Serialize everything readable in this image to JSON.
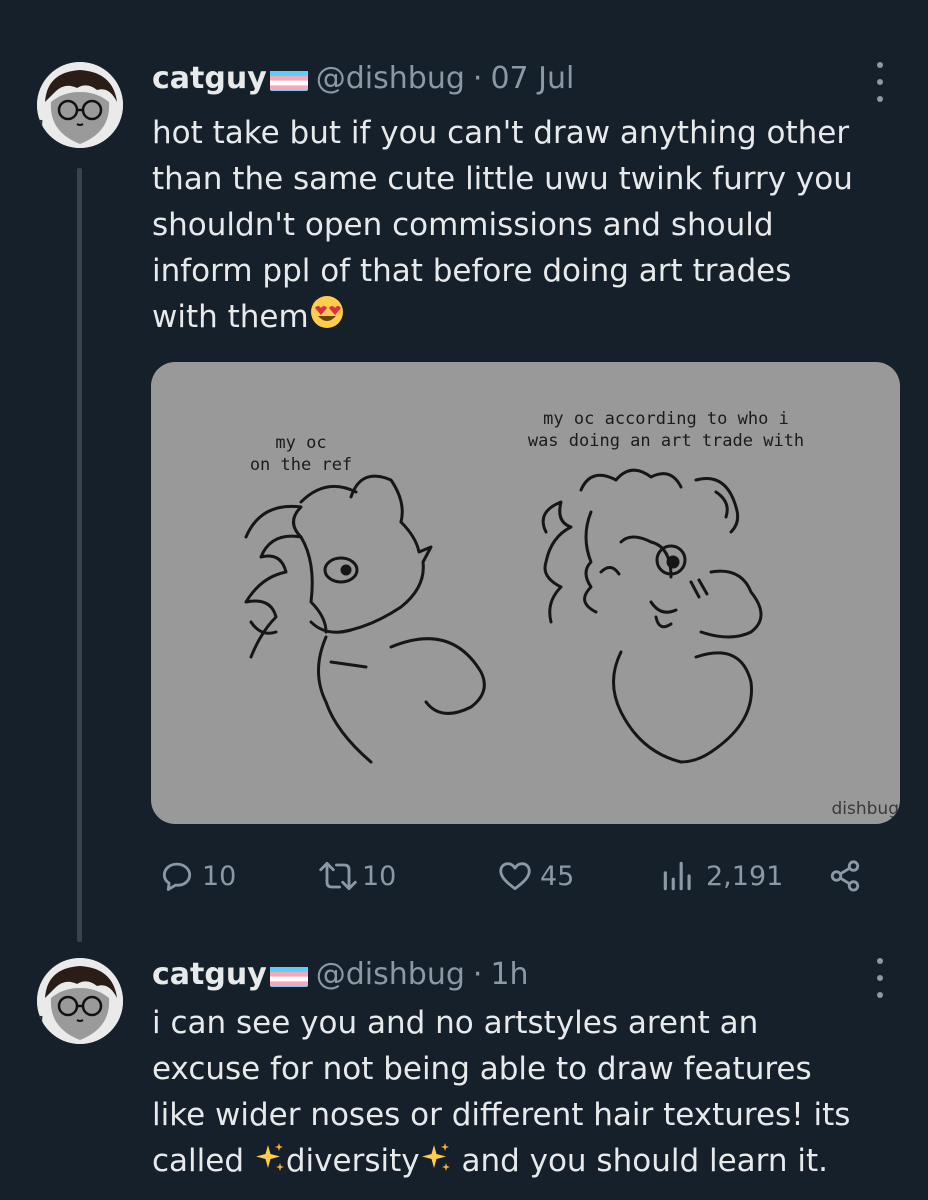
{
  "tweets": [
    {
      "name": "catguy",
      "handle": "@dishbug",
      "separator": "·",
      "time": "07 Jul",
      "text_lines": [
        "hot take but if you can't draw anything other",
        "than the same cute little uwu twink furry you",
        "shouldn't open commissions and should",
        "inform ppl of that before doing art trades",
        "with them"
      ],
      "emoji": "heart-eyes-emoji",
      "media": {
        "left_caption": [
          "my oc",
          "on the ref"
        ],
        "right_caption": [
          "my oc according to who i",
          "was doing an art trade with"
        ],
        "watermark": "dishbug"
      },
      "stats": {
        "replies": "10",
        "retweets": "10",
        "likes": "45",
        "views": "2,191"
      }
    },
    {
      "name": "catguy",
      "handle": "@dishbug",
      "separator": "·",
      "time": "1h",
      "text_lines": [
        "i can see you and no artstyles arent an",
        "excuse for not being able to draw features",
        "like wider noses or different hair textures! its"
      ],
      "last_line": {
        "part1": "called ",
        "part2": "diversity",
        "part3": " and you should learn it."
      }
    }
  ],
  "colors": {
    "background": "#15202b",
    "text": "#e7e9ea",
    "muted": "#8b98a5",
    "thread_line": "#38444d",
    "media_bg": "#999999"
  }
}
